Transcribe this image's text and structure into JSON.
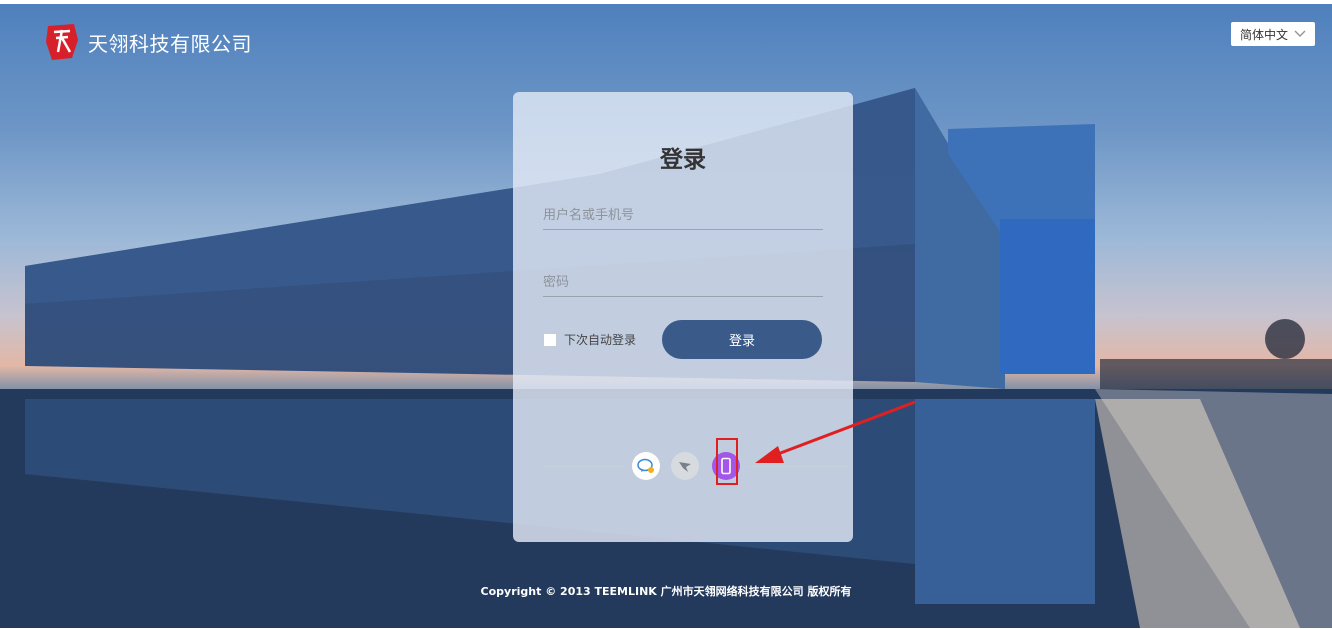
{
  "brand": {
    "name": "天翎科技有限公司",
    "logo_icon": "tianling-logo-icon"
  },
  "language": {
    "selected": "简体中文"
  },
  "login": {
    "title": "登录",
    "username_placeholder": "用户名或手机号",
    "password_placeholder": "密码",
    "remember_label": "下次自动登录",
    "submit_label": "登录"
  },
  "alt_login_icons": [
    "wechat-chat-icon",
    "dingtalk-icon",
    "mobile-phone-icon"
  ],
  "annotation": {
    "color": "#e02020"
  },
  "footer": {
    "copyright": "Copyright © 2013 TEEMLINK 广州市天翎网络科技有限公司 版权所有"
  },
  "colors": {
    "accent": "#3a5a8a",
    "phone_icon": "#a257e8"
  }
}
